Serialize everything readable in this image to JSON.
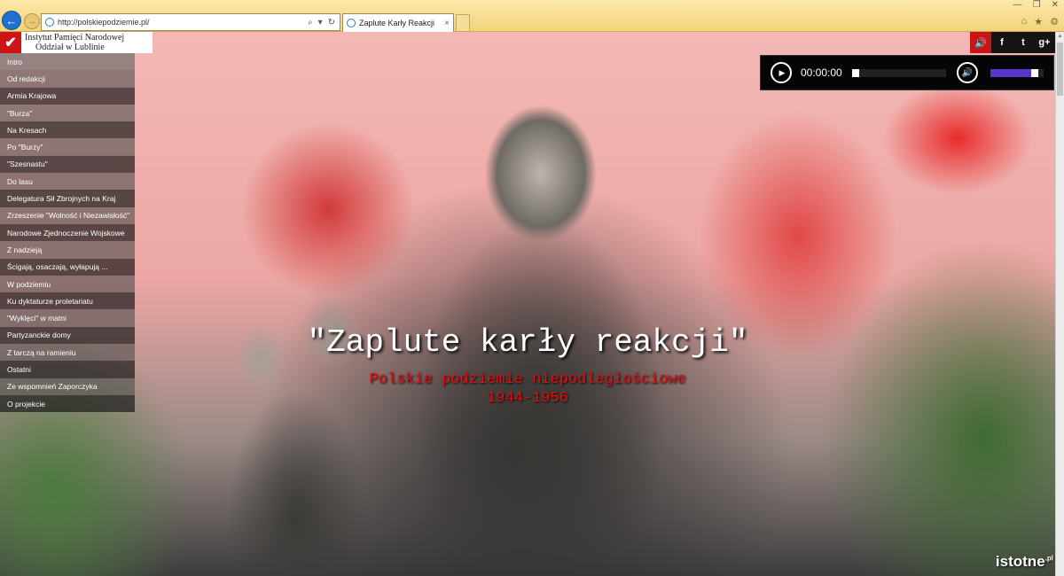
{
  "browser": {
    "url": "http://polskiepodziemie.pl/",
    "tab_title": "Zaplute Karły Reakcji",
    "tab_close": "×",
    "back_icon": "back-arrow-icon",
    "forward_icon": "forward-arrow-icon",
    "address_tools": [
      "⌕",
      "▾",
      "↻"
    ],
    "window_controls": [
      "—",
      "❐",
      "✕"
    ],
    "toolbar_icons": [
      "⌂",
      "★",
      "⚙"
    ]
  },
  "logo": {
    "line1": "Instytut Pamięci Narodowej",
    "line2": "Oddział w Lublinie",
    "mark": "✔"
  },
  "menu": {
    "items": [
      "Intro",
      "Od redakcji",
      "Armia Krajowa",
      "\"Burza\"",
      "Na Kresach",
      "Po \"Burzy\"",
      "\"Szesnastu\"",
      "Do lasu",
      "Delegatura Sił Zbrojnych na Kraj",
      "Zrzeszenie \"Wolność i Niezawisłość\"",
      "Narodowe Zjednoczenie Wojskowe",
      "Z nadzieją",
      "Ścigają, osaczają, wyłapują ...",
      "W podziemiu",
      "Ku dyktaturze proletariatu",
      "\"Wyklęci\" w matni",
      "Partyzanckie domy",
      "Z tarczą na ramieniu",
      "Ostatni",
      "Ze wspomnień Zaporczyka",
      "O projekcie"
    ]
  },
  "social": {
    "sound": "🔊",
    "facebook": "f",
    "twitter": "t",
    "googleplus": "g+"
  },
  "player": {
    "play_icon": "▶",
    "time": "00:00:00",
    "progress": 0,
    "volume_icon": "🔊",
    "volume": 0.9
  },
  "hero": {
    "title": "\"Zaplute karły reakcji\"",
    "subtitle": "Polskie podziemie niepodległościowe",
    "years": "1944-1956"
  },
  "watermark": {
    "text": "istotne",
    "suffix": ".pl"
  },
  "colors": {
    "accent": "#cc1515",
    "volume_fill": "#5a34c8"
  }
}
